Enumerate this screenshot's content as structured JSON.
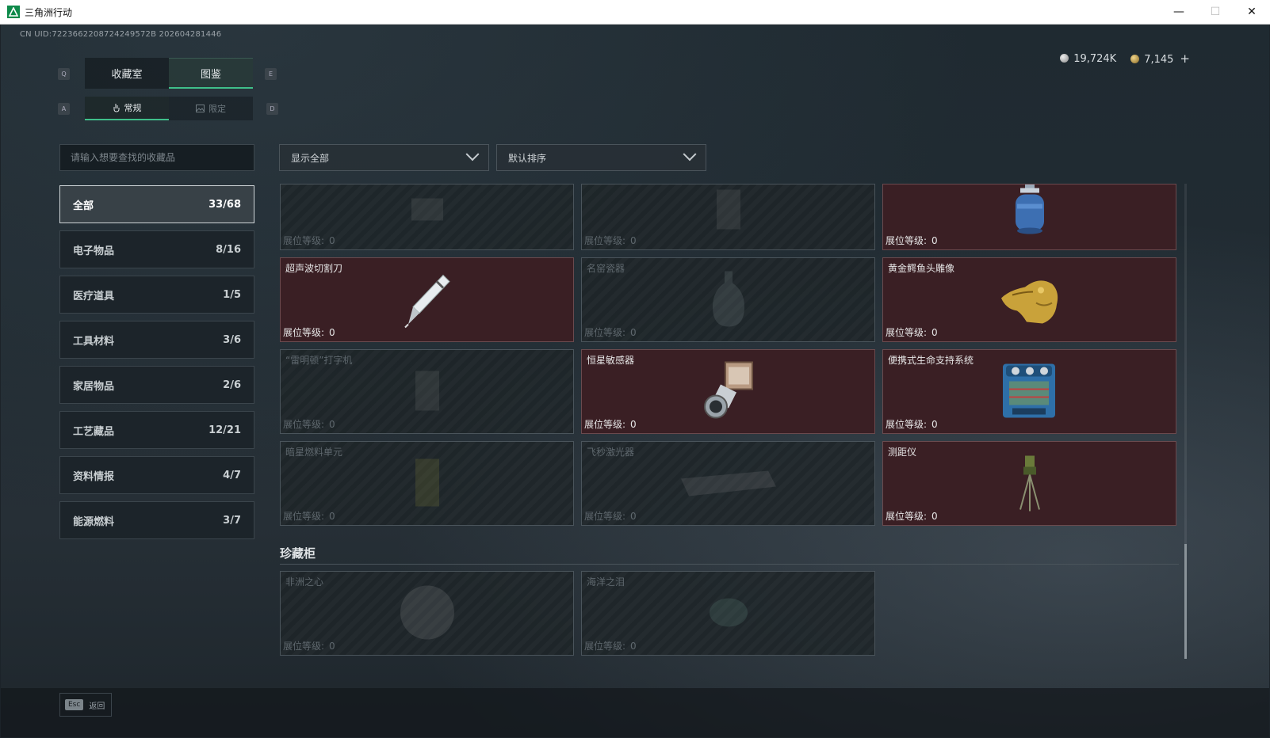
{
  "window": {
    "title": "三角洲行动",
    "minimize": "—",
    "maximize": "☐",
    "close": "✕"
  },
  "uid": "CN UID:7223662208724249572B 202604281446",
  "currency": {
    "silver": "19,724K",
    "gold": "7,145",
    "plus": "+"
  },
  "keyhints": {
    "q": "Q",
    "e": "E",
    "a": "A",
    "d": "D"
  },
  "tabs": {
    "main": [
      "收藏室",
      "图鉴"
    ],
    "sub": [
      "常规",
      "限定"
    ]
  },
  "search": {
    "placeholder": "请输入想要查找的收藏品"
  },
  "filters": {
    "show": "显示全部",
    "sort": "默认排序"
  },
  "categories": [
    {
      "label": "全部",
      "count": "33/68"
    },
    {
      "label": "电子物品",
      "count": "8/16"
    },
    {
      "label": "医疗道具",
      "count": "1/5"
    },
    {
      "label": "工具材料",
      "count": "3/6"
    },
    {
      "label": "家居物品",
      "count": "2/6"
    },
    {
      "label": "工艺藏品",
      "count": "12/21"
    },
    {
      "label": "资料情报",
      "count": "4/7"
    },
    {
      "label": "能源燃料",
      "count": "3/7"
    }
  ],
  "level_label": "展位等级:",
  "items": [
    {
      "name": "",
      "level": "0",
      "owned": false,
      "icon": "relic-icon"
    },
    {
      "name": "",
      "level": "0",
      "owned": false,
      "icon": "shrine-icon"
    },
    {
      "name": "",
      "level": "0",
      "owned": true,
      "icon": "gas-canister-icon"
    },
    {
      "name": "超声波切割刀",
      "level": "0",
      "owned": true,
      "icon": "ultrasonic-cutter-icon"
    },
    {
      "name": "名窑瓷器",
      "level": "0",
      "owned": false,
      "icon": "porcelain-vase-icon"
    },
    {
      "name": "黄金鳄鱼头雕像",
      "level": "0",
      "owned": true,
      "icon": "golden-crocodile-icon"
    },
    {
      "name": "“雷明顿”打字机",
      "level": "0",
      "owned": false,
      "icon": "typewriter-icon"
    },
    {
      "name": "恒星敏感器",
      "level": "0",
      "owned": true,
      "icon": "star-sensor-icon"
    },
    {
      "name": "便携式生命支持系统",
      "level": "0",
      "owned": true,
      "icon": "life-support-icon"
    },
    {
      "name": "暗星燃料单元",
      "level": "0",
      "owned": false,
      "icon": "fuel-cell-icon"
    },
    {
      "name": "飞秒激光器",
      "level": "0",
      "owned": false,
      "icon": "laser-icon"
    },
    {
      "name": "测距仪",
      "level": "0",
      "owned": true,
      "icon": "rangefinder-icon"
    }
  ],
  "treasure": {
    "title": "珍藏柜",
    "items": [
      {
        "name": "非洲之心",
        "level": "0",
        "owned": false,
        "icon": "diamond-icon"
      },
      {
        "name": "海洋之泪",
        "level": "0",
        "owned": false,
        "icon": "gem-icon"
      }
    ]
  },
  "footer": {
    "key": "Esc",
    "label": "返回"
  },
  "colors": {
    "accent": "#3fbf8a",
    "owned_bg": "#3a1f24",
    "locked_bg": "#1e2428"
  }
}
